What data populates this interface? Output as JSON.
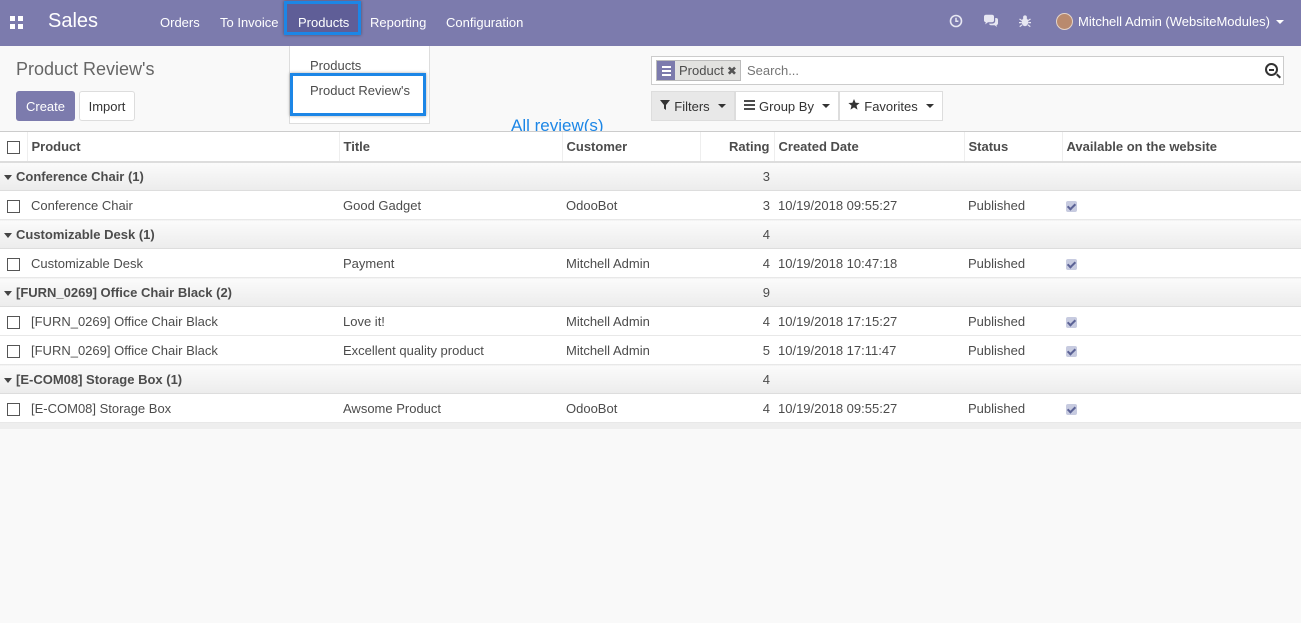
{
  "navbar": {
    "app_name": "Sales",
    "menu": [
      "Orders",
      "To Invoice",
      "Products",
      "Reporting",
      "Configuration"
    ],
    "active_menu": "Products",
    "user": "Mitchell Admin (WebsiteModules)"
  },
  "dropdown": {
    "items": [
      "Products",
      "Product Review's"
    ],
    "highlighted": "Product Review's"
  },
  "page": {
    "title": "Product Review's",
    "create_label": "Create",
    "import_label": "Import"
  },
  "search": {
    "facet": "Product",
    "placeholder": "Search...",
    "filters_label": "Filters",
    "groupby_label": "Group By",
    "favorites_label": "Favorites"
  },
  "annotation": "All review(s)",
  "table": {
    "columns": [
      "Product",
      "Title",
      "Customer",
      "Rating",
      "Created Date",
      "Status",
      "Available on the website"
    ],
    "groups": [
      {
        "label": "Conference Chair (1)",
        "total": "3",
        "rows": [
          {
            "product": "Conference Chair",
            "title": "Good Gadget",
            "customer": "OdooBot",
            "rating": "3",
            "date": "10/19/2018 09:55:27",
            "status": "Published"
          }
        ]
      },
      {
        "label": "Customizable Desk (1)",
        "total": "4",
        "rows": [
          {
            "product": "Customizable Desk",
            "title": "Payment",
            "customer": "Mitchell Admin",
            "rating": "4",
            "date": "10/19/2018 10:47:18",
            "status": "Published"
          }
        ]
      },
      {
        "label": "[FURN_0269] Office Chair Black (2)",
        "total": "9",
        "rows": [
          {
            "product": "[FURN_0269] Office Chair Black",
            "title": "Love it!",
            "customer": "Mitchell Admin",
            "rating": "4",
            "date": "10/19/2018 17:15:27",
            "status": "Published"
          },
          {
            "product": "[FURN_0269] Office Chair Black",
            "title": "Excellent quality product",
            "customer": "Mitchell Admin",
            "rating": "5",
            "date": "10/19/2018 17:11:47",
            "status": "Published"
          }
        ]
      },
      {
        "label": "[E-COM08] Storage Box (1)",
        "total": "4",
        "rows": [
          {
            "product": "[E-COM08] Storage Box",
            "title": "Awsome Product",
            "customer": "OdooBot",
            "rating": "4",
            "date": "10/19/2018 09:55:27",
            "status": "Published"
          }
        ]
      }
    ]
  }
}
